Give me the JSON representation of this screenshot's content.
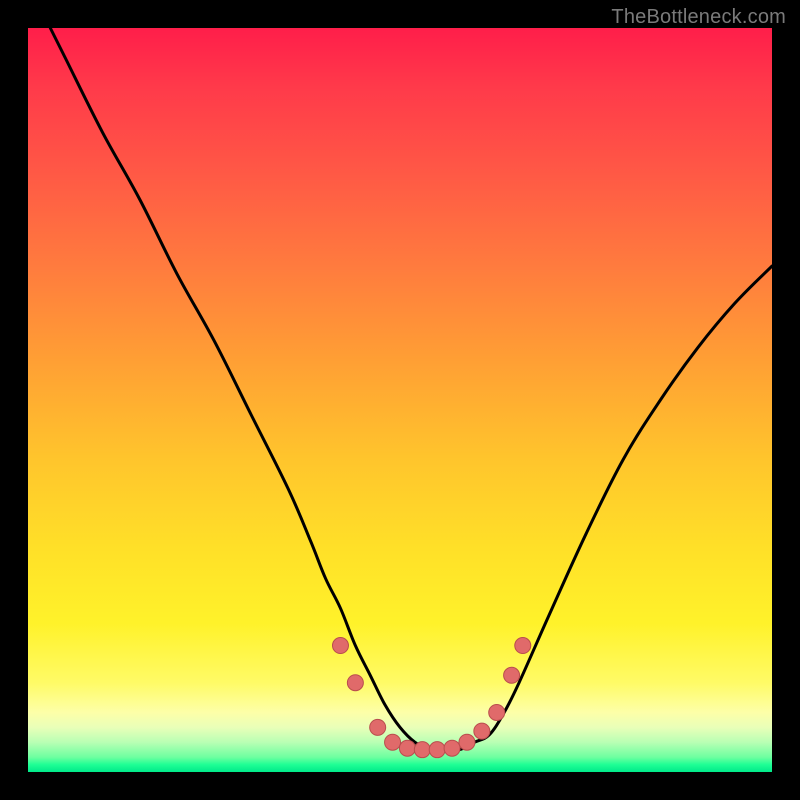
{
  "watermark": "TheBottleneck.com",
  "colors": {
    "frame": "#000000",
    "curve_stroke": "#000000",
    "marker_fill": "#e06a6a",
    "marker_stroke": "#b94d4d",
    "gradient_top": "#ff1e4a",
    "gradient_bottom": "#00e98a"
  },
  "chart_data": {
    "type": "line",
    "title": "",
    "xlabel": "",
    "ylabel": "",
    "xlim": [
      0,
      100
    ],
    "ylim": [
      0,
      100
    ],
    "grid": false,
    "legend": false,
    "series": [
      {
        "name": "curve",
        "x": [
          3,
          5,
          10,
          15,
          20,
          25,
          30,
          35,
          38,
          40,
          42,
          44,
          46,
          48,
          50,
          52,
          54,
          56,
          58,
          60,
          62,
          64,
          66,
          70,
          75,
          80,
          85,
          90,
          95,
          100
        ],
        "y": [
          100,
          96,
          86,
          77,
          67,
          58,
          48,
          38,
          31,
          26,
          22,
          17,
          13,
          9,
          6,
          4,
          3,
          3,
          3,
          4,
          5,
          8,
          12,
          21,
          32,
          42,
          50,
          57,
          63,
          68
        ]
      }
    ],
    "markers": [
      {
        "x": 42,
        "y": 17
      },
      {
        "x": 44,
        "y": 12
      },
      {
        "x": 47,
        "y": 6
      },
      {
        "x": 49,
        "y": 4
      },
      {
        "x": 51,
        "y": 3.2
      },
      {
        "x": 53,
        "y": 3
      },
      {
        "x": 55,
        "y": 3
      },
      {
        "x": 57,
        "y": 3.2
      },
      {
        "x": 59,
        "y": 4
      },
      {
        "x": 61,
        "y": 5.5
      },
      {
        "x": 63,
        "y": 8
      },
      {
        "x": 65,
        "y": 13
      },
      {
        "x": 66.5,
        "y": 17
      }
    ]
  }
}
